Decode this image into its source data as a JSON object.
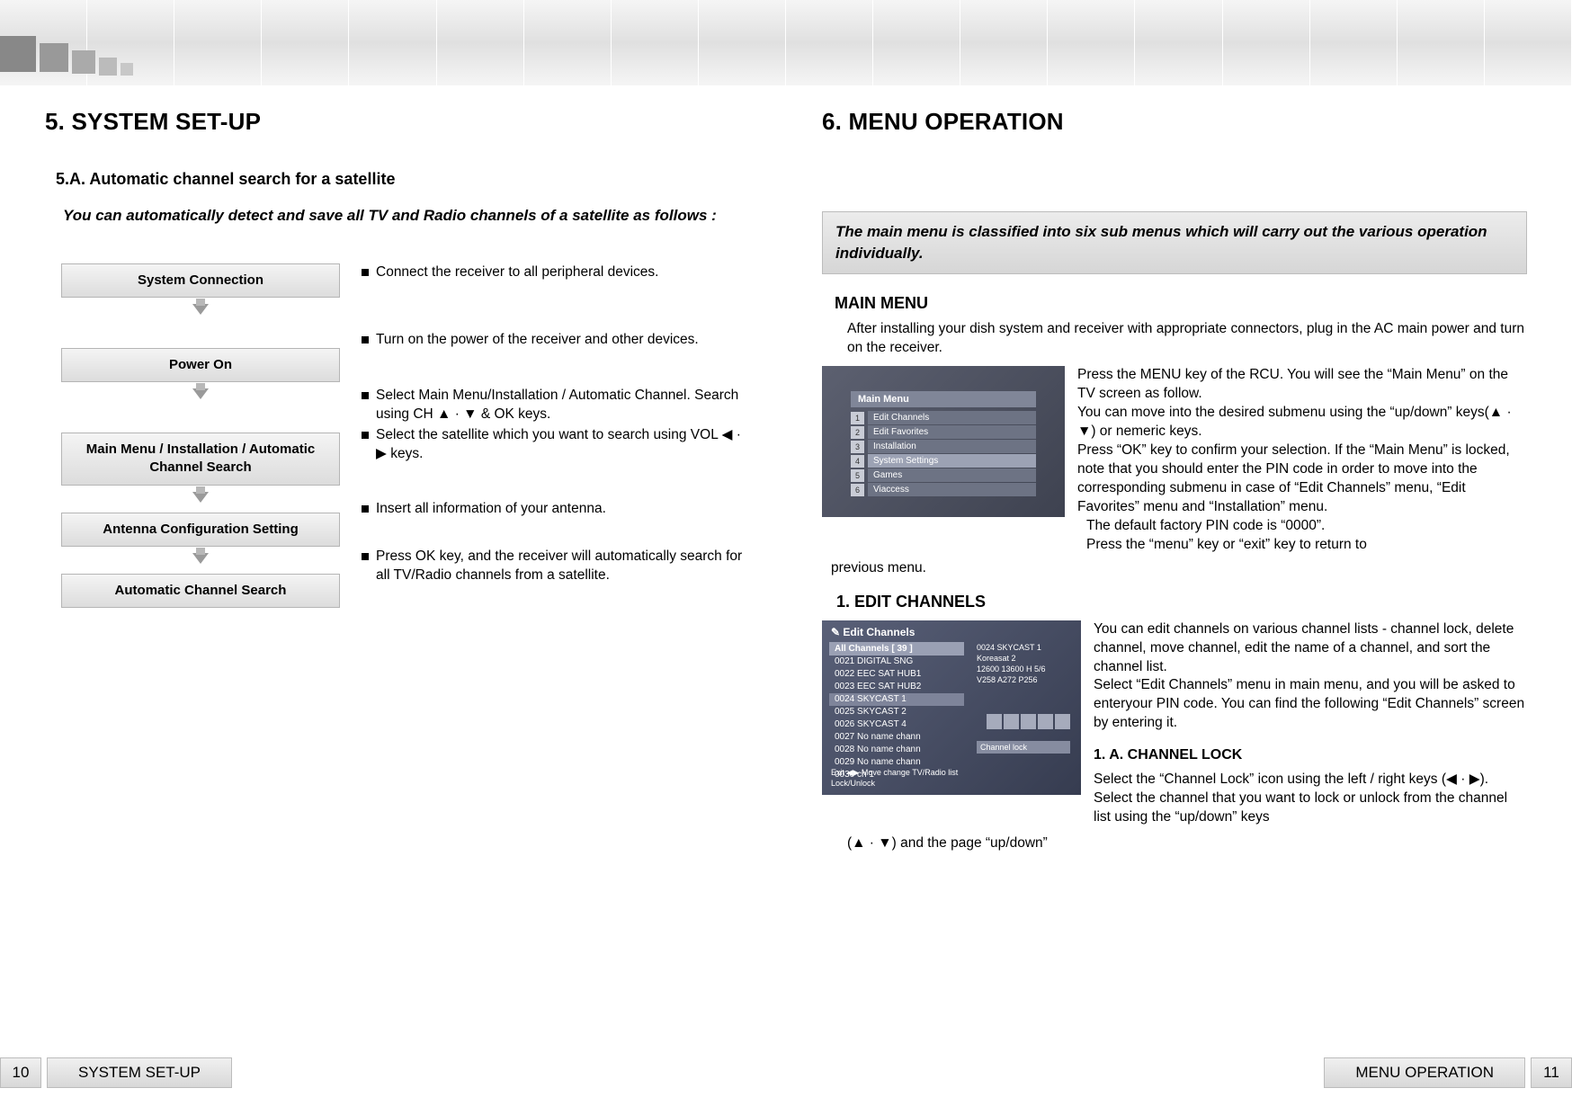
{
  "left_page": {
    "heading": "5. SYSTEM SET-UP",
    "sub_heading": "5.A. Automatic channel search for a satellite",
    "intro": "You can automatically detect and save all TV and Radio channels of a satellite as follows :",
    "steps": [
      {
        "label": "System Connection",
        "desc": [
          "Connect the receiver to all peripheral devices."
        ]
      },
      {
        "label": "Power On",
        "desc": [
          "Turn on the power of the receiver and other devices."
        ]
      },
      {
        "label": "Main Menu / Installation / Automatic Channel Search",
        "desc": [
          "Select Main Menu/Installation / Automatic Channel. Search using CH ▲ · ▼ & OK keys.",
          "Select the satellite which you want to search using VOL ◀ · ▶ keys."
        ]
      },
      {
        "label": "Antenna Configuration Setting",
        "desc": [
          "Insert all information of your antenna."
        ]
      },
      {
        "label": "Automatic Channel Search",
        "desc": [
          "Press OK key, and the receiver will automatically search for all TV/Radio channels from a satellite."
        ]
      }
    ],
    "footer_label": "SYSTEM SET-UP",
    "page_num": "10"
  },
  "right_page": {
    "heading": "6. MENU OPERATION",
    "callout": "The main menu is classified into six sub menus which will carry out the various operation individually.",
    "main_menu": {
      "heading": "MAIN MENU",
      "intro": "After installing your dish system and receiver with appropriate connectors, plug in the AC main power and turn on the receiver.",
      "side_para": "Press the MENU key of the RCU. You will see the “Main Menu” on the TV screen as  follow.\nYou can move into the desired submenu using the “up/down” keys(▲ · ▼) or nemeric keys.\nPress “OK” key to confirm your selection. If the “Main Menu” is locked, note that you should enter the PIN code in order to move into the corresponding submenu in case of “Edit Channels” menu, “Edit Favorites” menu and “Installation” menu.",
      "indent_line1": "The default factory PIN code is “0000”.",
      "indent_line2": "Press the “menu” key or “exit” key to return to",
      "previous_menu": "previous menu.",
      "screenshot": {
        "title": "Main Menu",
        "items": [
          "Edit Channels",
          "Edit Favorites",
          "Installation",
          "System Settings",
          "Games",
          "Viaccess"
        ]
      }
    },
    "edit_channels": {
      "heading": "1. EDIT CHANNELS",
      "para": "You  can edit channels on various channel lists - channel lock, delete channel, move channel, edit the name of a channel, and sort the channel list.\nSelect “Edit Channels” menu in main menu, and you will be asked to enteryour PIN code. You can find the following “Edit Channels” screen by entering it.",
      "sub_heading": "1. A.  CHANNEL LOCK",
      "sub_para": "Select the “Channel Lock” icon using the left / right keys (◀ · ▶). Select the channel that you want to lock or unlock from the channel list using the “up/down” keys",
      "tail": "(▲ · ▼) and  the page “up/down”",
      "screenshot": {
        "title": "✎ Edit Channels",
        "all_header": "All Channels  [ 39 ]",
        "channels": [
          "0021  DIGITAL SNG",
          "0022  EEC SAT HUB1",
          "0023  EEC SAT HUB2",
          "0024  SKYCAST 1",
          "0025  SKYCAST 2",
          "0026  SKYCAST 4",
          "0027  No name chann",
          "0028  No name chann",
          "0029  No name chann",
          "0030  ch 1"
        ],
        "right_info": [
          "0024  SKYCAST 1",
          "Koreasat 2",
          "12600 13600 H 5/6",
          "V258 A272 P256"
        ],
        "channel_lock": "Channel lock",
        "hint_line1": "Exit   ◀▶ Move   change TV/Radio list",
        "hint_line2": "Lock/Unlock"
      }
    },
    "footer_label": "MENU OPERATION",
    "page_num": "11"
  }
}
